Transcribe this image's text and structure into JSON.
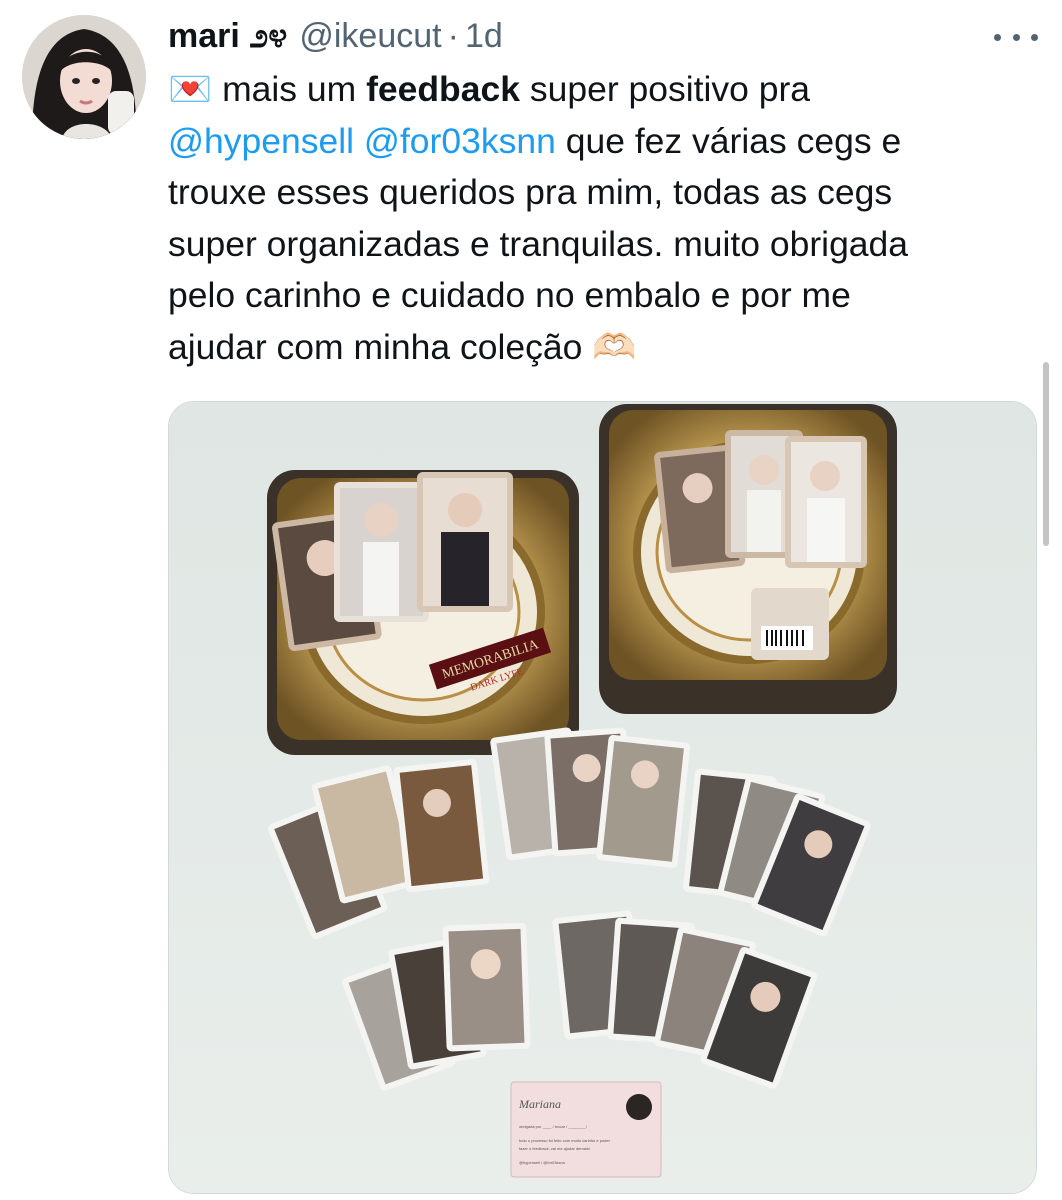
{
  "tweet": {
    "display_name": "mari ೨೪",
    "handle": "@ikeucut",
    "dot": "·",
    "time": "1d",
    "lines": [
      {
        "envelope": "💌",
        "pre": " mais um ",
        "bold": "feedback",
        "post": " super positivo pra"
      },
      {
        "mention1": "@hypensell",
        "space": " ",
        "mention2": "@for03ksnn",
        "post": " que fez várias cegs e"
      },
      {
        "text": "trouxe esses queridos pra mim, todas as cegs"
      },
      {
        "text": "super organizadas e tranquilas. muito obrigada"
      },
      {
        "text": "pelo carinho e cuidado no embalo e por me"
      },
      {
        "text": "ajudar com minha coleção ",
        "emoji": "🫶🏻"
      }
    ],
    "media": {
      "tin_left_label": "MEMORABILIA",
      "tin_left_sublabel": "DARK LYFE",
      "note_title": "Mariana",
      "note_lines": [
        "obrigada por ____ / trocar / ________!",
        "tudo o processo foi feito com muito carinho e poder",
        "fazer o feedback, vai me ajudar demais!",
        "@hypensell / @for03ksnn"
      ]
    }
  },
  "colors": {
    "accent": "#1d9bf0",
    "text": "#0f1419",
    "secondary": "#536471"
  }
}
